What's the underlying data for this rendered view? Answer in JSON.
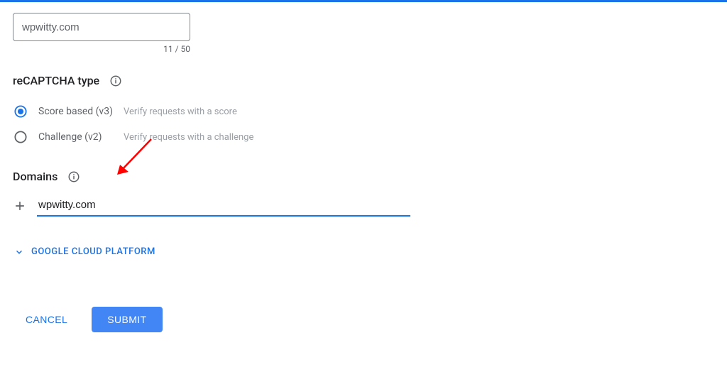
{
  "label_field": {
    "value": "wpwitty.com",
    "counter": "11 / 50"
  },
  "recaptcha": {
    "heading": "reCAPTCHA type",
    "options": [
      {
        "label": "Score based (v3)",
        "desc": "Verify requests with a score",
        "selected": true
      },
      {
        "label": "Challenge (v2)",
        "desc": "Verify requests with a challenge",
        "selected": false
      }
    ]
  },
  "domains": {
    "heading": "Domains",
    "value": "wpwitty.com"
  },
  "expander": {
    "label": "GOOGLE CLOUD PLATFORM"
  },
  "actions": {
    "cancel": "CANCEL",
    "submit": "SUBMIT"
  },
  "colors": {
    "primary": "#1a73e8",
    "filled_button": "#4285f4",
    "arrow": "#ff0000"
  }
}
